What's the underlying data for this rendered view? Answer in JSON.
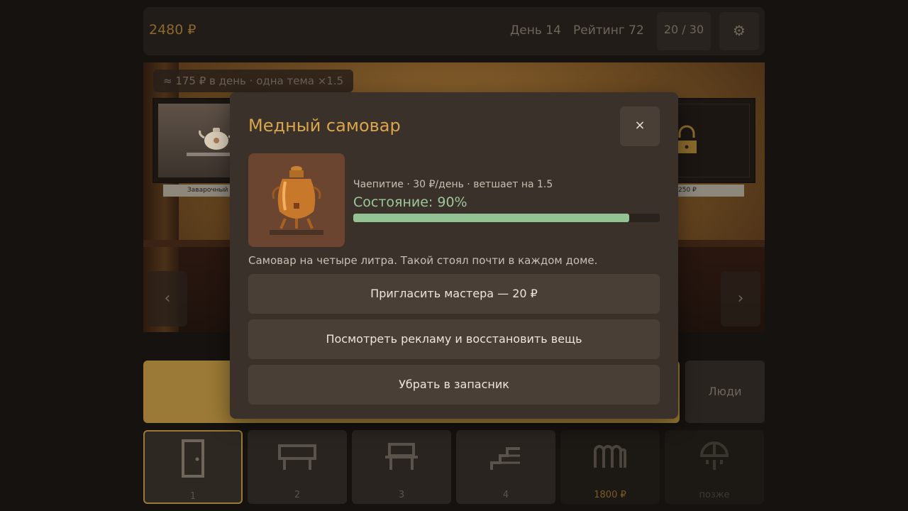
{
  "topbar": {
    "money": "2480 ₽",
    "day": "День 14",
    "rating": "Рейтинг 72",
    "capacity": "20 / 30",
    "settings_icon": "⚙"
  },
  "hall": {
    "income_info": "≈ 175 ₽ в день   ·   одна тема ×1.5",
    "left_exhibit_label": "Заварочный",
    "right_exhibit_label": "250 ₽",
    "prev_arrow": "‹",
    "next_arrow": "›"
  },
  "bottom": {
    "people_label": "Люди",
    "rooms": [
      {
        "label": "1",
        "icon": "door-icon",
        "state": "active"
      },
      {
        "label": "2",
        "icon": "bench-icon",
        "state": "normal"
      },
      {
        "label": "3",
        "icon": "table-icon",
        "state": "normal"
      },
      {
        "label": "4",
        "icon": "stairs-icon",
        "state": "normal"
      },
      {
        "label": "1800 ₽",
        "icon": "radiator-icon",
        "state": "price"
      },
      {
        "label": "позже",
        "icon": "shower-icon",
        "state": "later"
      }
    ]
  },
  "modal": {
    "title": "Медный самовар",
    "close_label": "×",
    "meta": "Чаепитие · 30 ₽/день · ветшает на 1.5",
    "condition_label": "Состояние: 90%",
    "condition_value": 0.9,
    "description": "Самовар на четыре литра. Такой стоял почти в каждом доме.",
    "actions": {
      "repair": "Пригласить мастера — 20 ₽",
      "watch_ad": "Посмотреть рекламу и восстановить вещь",
      "store": "Убрать в запасник"
    }
  },
  "colors": {
    "accent": "#d8a54b",
    "condition": "#93c393",
    "panel": "#3a312b",
    "button": "#4a3f36"
  }
}
